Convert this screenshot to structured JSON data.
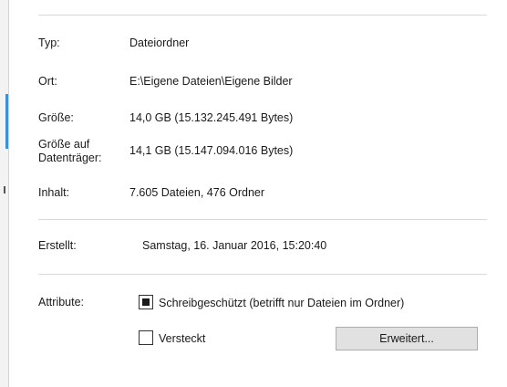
{
  "properties": {
    "type": {
      "label": "Typ:",
      "value": "Dateiordner"
    },
    "location": {
      "label": "Ort:",
      "value": "E:\\Eigene Dateien\\Eigene Bilder"
    },
    "size": {
      "label": "Größe:",
      "value": "14,0 GB (15.132.245.491 Bytes)"
    },
    "size_on_disk": {
      "label_line1": "Größe auf",
      "label_line2": "Datenträger:",
      "value": "14,1 GB (15.147.094.016 Bytes)"
    },
    "contents": {
      "label": "Inhalt:",
      "value": "7.605 Dateien, 476 Ordner"
    },
    "created": {
      "label": "Erstellt:",
      "value": "Samstag, 16. Januar 2016, 15:20:40"
    }
  },
  "attributes": {
    "label": "Attribute:",
    "readonly": {
      "label": "Schreibgeschützt (betrifft nur Dateien im Ordner)",
      "state": "indeterminate"
    },
    "hidden": {
      "label": "Versteckt",
      "checked": false
    },
    "advanced_button": "Erweitert..."
  },
  "colors": {
    "accent": "#3d8fd6",
    "separator": "#d9d9d9"
  }
}
